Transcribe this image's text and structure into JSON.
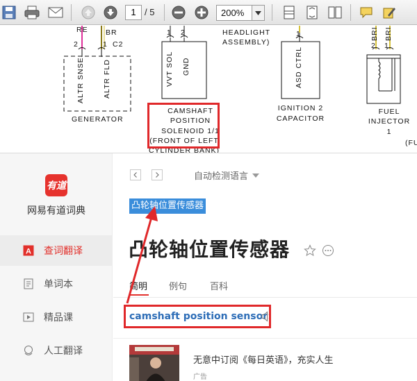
{
  "pdf_viewer": {
    "toolbar": {
      "page_current": "1",
      "page_total": "/ 5",
      "zoom": "200%"
    },
    "schematic": {
      "wire_labels": {
        "red": "RE",
        "brn_left": "BR",
        "c2": "C2",
        "pin2_left": "2",
        "pin1_left": "1",
        "vvt_pin1": "1",
        "vvt_pin2": "2",
        "asd_pin": "1",
        "inj_pin2": "2",
        "inj_pin1": "1",
        "brn_inj1": "BRI",
        "brn_inj2": "BRI"
      },
      "generator": {
        "altr_snse": "ALTR SNSE",
        "altr_fld": "ALTR FLD",
        "label": "GENERATOR"
      },
      "vvt": {
        "vvt_sol": "VVT SOL",
        "gnd": "GND"
      },
      "camshaft_label": [
        "CAMSHAFT",
        "POSITION",
        "SOLENOID 1/1",
        "(FRONT OF LEFT",
        "CYLINDER BANK)"
      ],
      "headlight": [
        "HEADLIGHT",
        "ASSEMBLY)"
      ],
      "ignition": {
        "asd_ctrl": "ASD CTRL",
        "label": [
          "IGNITION 2",
          "CAPACITOR"
        ]
      },
      "fuel_injector": [
        "FUEL",
        "INJECTOR",
        "1"
      ],
      "edge_text": "(FU"
    }
  },
  "youdao": {
    "logo_text": "有道",
    "app_name": "网易有道词典",
    "nav": [
      {
        "label": "查词翻译",
        "icon": "translate-icon",
        "active": true
      },
      {
        "label": "单词本",
        "icon": "wordbook-icon",
        "active": false
      },
      {
        "label": "精品课",
        "icon": "course-icon",
        "active": false
      },
      {
        "label": "人工翻译",
        "icon": "human-translate-icon",
        "active": false
      }
    ],
    "language_select": "自动检测语言",
    "query_text": "凸轮轴位置传感器",
    "headword": "凸轮轴位置传感器",
    "tabs": [
      "简明",
      "例句",
      "百科"
    ],
    "translation": "camshaft position sensor",
    "ad": {
      "text": "无意中订阅《每日英语》，充实人生",
      "label": "广告"
    },
    "colors": {
      "brand_red": "#e6322d",
      "highlight_blue": "#3a8ddb",
      "translation_blue": "#2d6db7",
      "annotation_red": "#e0282a"
    }
  }
}
